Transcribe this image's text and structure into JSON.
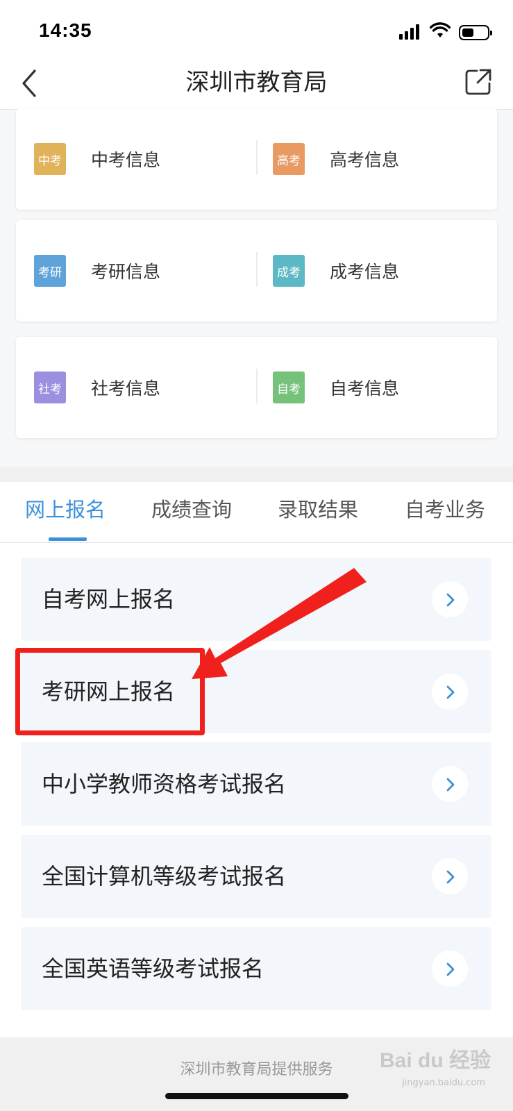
{
  "status_bar": {
    "time": "14:35"
  },
  "nav": {
    "title": "深圳市教育局"
  },
  "info_cards": [
    {
      "left": {
        "badge": "中考",
        "label": "中考信息",
        "color": "#e0b25a"
      },
      "right": {
        "badge": "高考",
        "label": "高考信息",
        "color": "#e89a62"
      }
    },
    {
      "left": {
        "badge": "考研",
        "label": "考研信息",
        "color": "#5ea3d9"
      },
      "right": {
        "badge": "成考",
        "label": "成考信息",
        "color": "#5cb8c4"
      }
    },
    {
      "left": {
        "badge": "社考",
        "label": "社考信息",
        "color": "#9b8fe0"
      },
      "right": {
        "badge": "自考",
        "label": "自考信息",
        "color": "#76c27b"
      }
    }
  ],
  "tabs": [
    {
      "label": "网上报名",
      "active": true
    },
    {
      "label": "成绩查询",
      "active": false
    },
    {
      "label": "录取结果",
      "active": false
    },
    {
      "label": "自考业务",
      "active": false
    }
  ],
  "list_items": [
    {
      "label": "自考网上报名"
    },
    {
      "label": "考研网上报名"
    },
    {
      "label": "中小学教师资格考试报名"
    },
    {
      "label": "全国计算机等级考试报名"
    },
    {
      "label": "全国英语等级考试报名"
    }
  ],
  "footer": {
    "text": "深圳市教育局提供服务"
  },
  "watermark": {
    "brand": "Bai du 经验",
    "sub": "jingyan.baidu.com"
  },
  "colors": {
    "accent": "#3b90d9",
    "annotation": "#f0201c"
  }
}
